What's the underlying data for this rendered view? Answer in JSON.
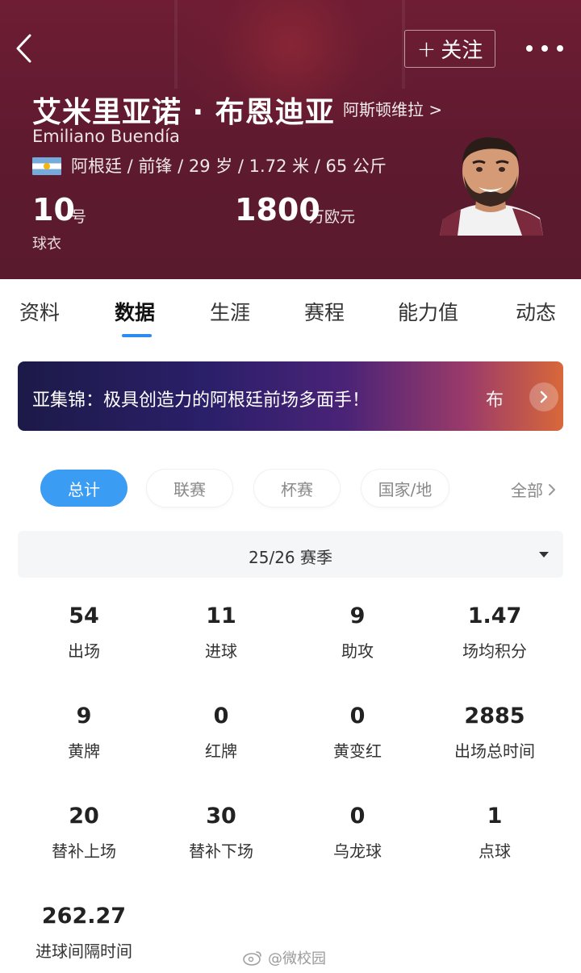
{
  "header": {
    "back_icon": "chevron-left-icon",
    "follow_label": "关注",
    "follow_icon": "plus-icon",
    "more_icon": "more-dots-icon",
    "name_cn": "艾米里亚诺 · 布恩迪亚",
    "club": "阿斯顿维拉 >",
    "name_en": "Emiliano Buendía",
    "flag_icon": "argentina-flag-icon",
    "bio": "阿根廷 / 前锋 / 29 岁 / 1.72 米 / 65 公斤",
    "shirt_number": "10",
    "shirt_unit": "号",
    "shirt_label": "球衣",
    "market_value": "1800",
    "market_value_unit": "万欧元",
    "background_color": "#5e1a2f"
  },
  "tabs": [
    {
      "label": "资料"
    },
    {
      "label": "数据"
    },
    {
      "label": "生涯"
    },
    {
      "label": "赛程"
    },
    {
      "label": "能力值"
    },
    {
      "label": "动态"
    }
  ],
  "active_tab": "数据",
  "banner": {
    "text": "亚集锦：极具创造力的阿根廷前场多面手！",
    "tail": "布",
    "arrow_icon": "chevron-right-icon"
  },
  "filters": [
    {
      "label": "总计",
      "active": true
    },
    {
      "label": "联赛",
      "active": false
    },
    {
      "label": "杯赛",
      "active": false
    },
    {
      "label": "国家/地",
      "active": false
    }
  ],
  "filter_all_label": "全部",
  "season": {
    "label": "25/26 赛季",
    "caret_icon": "caret-down-icon"
  },
  "stats": [
    {
      "value": "54",
      "label": "出场"
    },
    {
      "value": "11",
      "label": "进球"
    },
    {
      "value": "9",
      "label": "助攻"
    },
    {
      "value": "1.47",
      "label": "场均积分"
    },
    {
      "value": "9",
      "label": "黄牌"
    },
    {
      "value": "0",
      "label": "红牌"
    },
    {
      "value": "0",
      "label": "黄变红"
    },
    {
      "value": "2885",
      "label": "出场总时间"
    },
    {
      "value": "20",
      "label": "替补上场"
    },
    {
      "value": "30",
      "label": "替补下场"
    },
    {
      "value": "0",
      "label": "乌龙球"
    },
    {
      "value": "1",
      "label": "点球"
    },
    {
      "value": "262.27",
      "label": "进球间隔时间"
    }
  ],
  "watermark": "@微校园",
  "accent_color": "#3a9cf3"
}
